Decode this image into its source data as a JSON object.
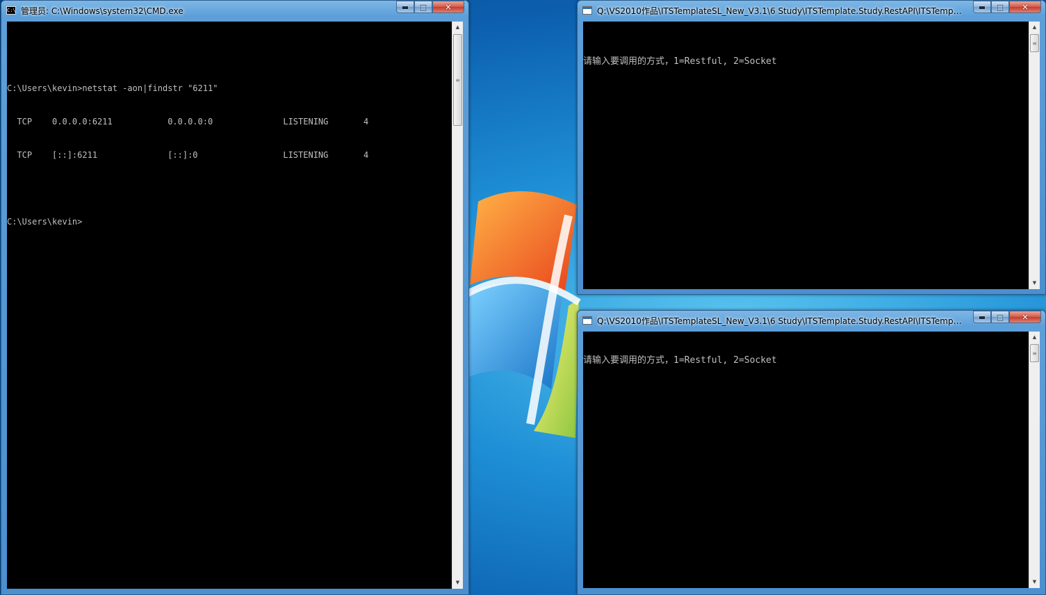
{
  "windows": {
    "cmd": {
      "title": "管理员: C:\\Windows\\system32\\CMD.exe",
      "icon": "cmd-icon",
      "lines": [
        "",
        "C:\\Users\\kevin>netstat -aon|findstr \"6211\"",
        "  TCP    0.0.0.0:6211           0.0.0.0:0              LISTENING       4",
        "  TCP    [::]:6211              [::]:0                 LISTENING       4",
        "",
        "C:\\Users\\kevin>"
      ]
    },
    "app1": {
      "title": "Q:\\VS2010作品\\ITSTemplateSL_New_V3.1\\6 Study\\ITSTemplate.Study.RestAPI\\ITSTemplate...",
      "icon": "console-app-icon",
      "lines": [
        "请输入要调用的方式，1=Restful, 2=Socket"
      ]
    },
    "app2": {
      "title": "Q:\\VS2010作品\\ITSTemplateSL_New_V3.1\\6 Study\\ITSTemplate.Study.RestAPI\\ITSTemplate...",
      "icon": "console-app-icon",
      "lines": [
        "请输入要调用的方式，1=Restful, 2=Socket"
      ]
    }
  },
  "controls": {
    "minimize": "▬",
    "maximize": "□",
    "close": "✕"
  },
  "colors": {
    "console_bg": "#000000",
    "console_text": "#c0c0c0",
    "frame": "#5d9fd8",
    "close": "#c43d2c"
  }
}
